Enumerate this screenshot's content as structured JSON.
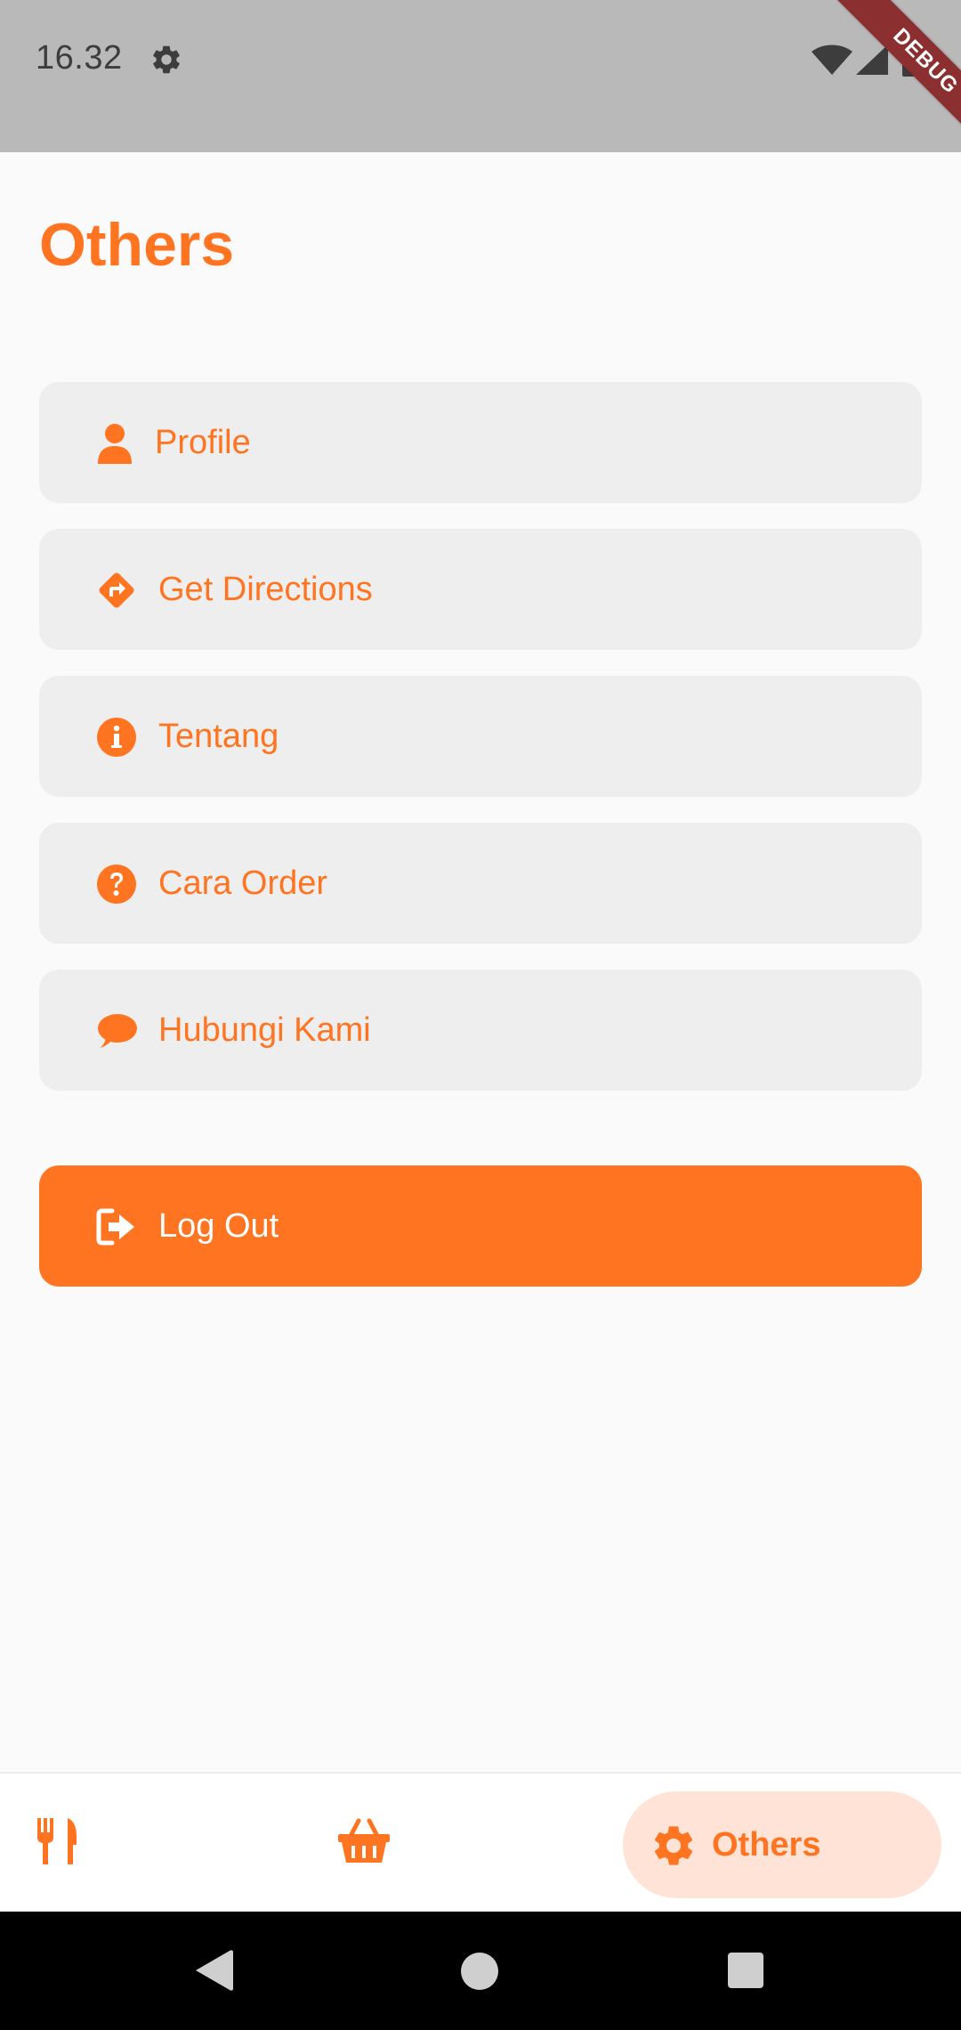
{
  "status_bar": {
    "time": "16.32",
    "icons": [
      "settings-icon",
      "wifi-icon",
      "signal-icon",
      "battery-icon"
    ],
    "debug_banner": "DEBUG"
  },
  "page": {
    "title": "Others"
  },
  "menu": {
    "items": [
      {
        "label": "Profile",
        "icon": "user-icon"
      },
      {
        "label": "Get Directions",
        "icon": "directions-icon"
      },
      {
        "label": "Tentang",
        "icon": "info-icon"
      },
      {
        "label": "Cara Order",
        "icon": "question-icon"
      },
      {
        "label": "Hubungi Kami",
        "icon": "chat-icon"
      }
    ],
    "logout": {
      "label": "Log Out",
      "icon": "logout-icon"
    }
  },
  "bottom_nav": {
    "items": [
      {
        "icon": "utensils-icon",
        "active": false
      },
      {
        "icon": "basket-icon",
        "active": false
      },
      {
        "icon": "gear-icon",
        "label": "Others",
        "active": true
      }
    ]
  },
  "system_nav": {
    "icons": [
      "back-icon",
      "home-icon",
      "recents-icon"
    ]
  },
  "colors": {
    "accent": "#ff7420",
    "accent_soft": "#ffe3d6",
    "item_background": "#eeeeee",
    "page_background": "#fafafa",
    "status_bar": "#b9b9b9"
  }
}
